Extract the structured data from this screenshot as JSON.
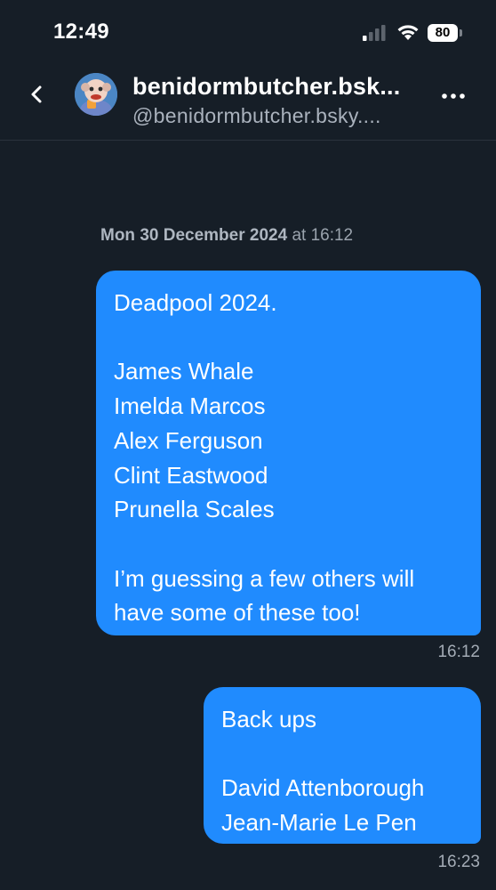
{
  "status_bar": {
    "time": "12:49",
    "battery": "80",
    "icons": [
      "cellular-signal-icon",
      "wifi-icon",
      "battery-icon"
    ]
  },
  "header": {
    "display_name": "benidormbutcher.bsk...",
    "handle": "@benidormbutcher.bsky....",
    "back_icon": "chevron-left-icon",
    "more_icon": "ellipsis-icon"
  },
  "conversation": {
    "date_separator": {
      "date": "Mon 30 December 2024",
      "time": "at 16:12"
    },
    "messages": [
      {
        "lines": [
          "Deadpool 2024.",
          "",
          "James Whale",
          "Imelda Marcos",
          "Alex Ferguson",
          "Clint Eastwood",
          "Prunella Scales",
          "",
          "I’m guessing a few others will",
          "have some of these too!"
        ],
        "time": "16:12"
      },
      {
        "lines": [
          "Back ups",
          "",
          "David Attenborough",
          "Jean-Marie Le Pen"
        ],
        "time": "16:23"
      }
    ]
  },
  "colors": {
    "background": "#161e27",
    "bubble": "#208bfe",
    "secondary_text": "#9aa3ad"
  }
}
